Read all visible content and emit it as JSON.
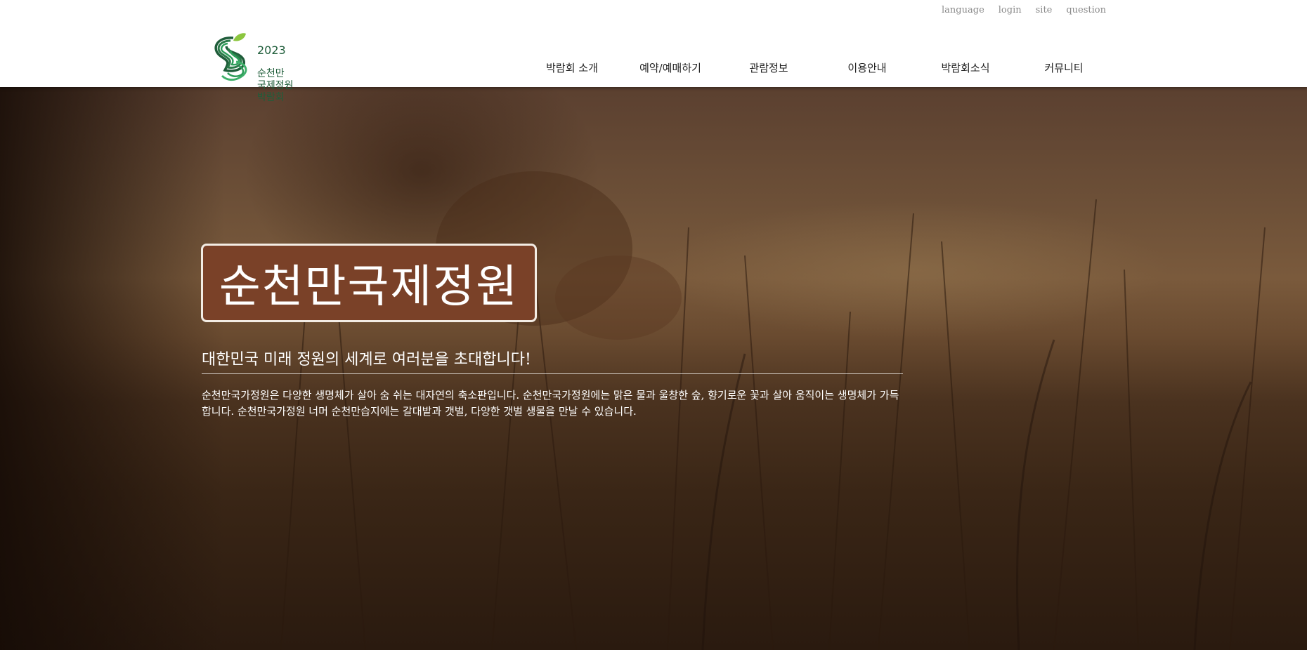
{
  "utility_links": [
    "language",
    "login",
    "site",
    "question"
  ],
  "logo": {
    "year": "2023",
    "name_lines": "순천만\n국제정원\n박람회",
    "brand_colors": [
      "#1f5d3a",
      "#2e9d5a",
      "#8cc63f"
    ]
  },
  "nav": {
    "items": [
      {
        "label": "박람회 소개"
      },
      {
        "label": "예약/예매하기"
      },
      {
        "label": "관람정보"
      },
      {
        "label": "이용안내"
      },
      {
        "label": "박람회소식"
      },
      {
        "label": "커뮤니티"
      }
    ]
  },
  "hero": {
    "title": "순천만국제정원",
    "subtitle": "대한민국 미래 정원의 세계로 여러분을 초대합니다!",
    "description": "순천만국가정원은 다양한 생명체가 살아 숨 쉬는 대자연의 축소판입니다. 순천만국가정원에는 맑은 물과 울창한 숲, 향기로운 꽃과 살아 움직이는 생명체가 가득합니다. 순천만국가정원 너머 순천만습지에는 갈대밭과 갯벌, 다양한 갯벌 생물을 만날 수 있습니다.",
    "title_box_color": "#7a4128"
  }
}
